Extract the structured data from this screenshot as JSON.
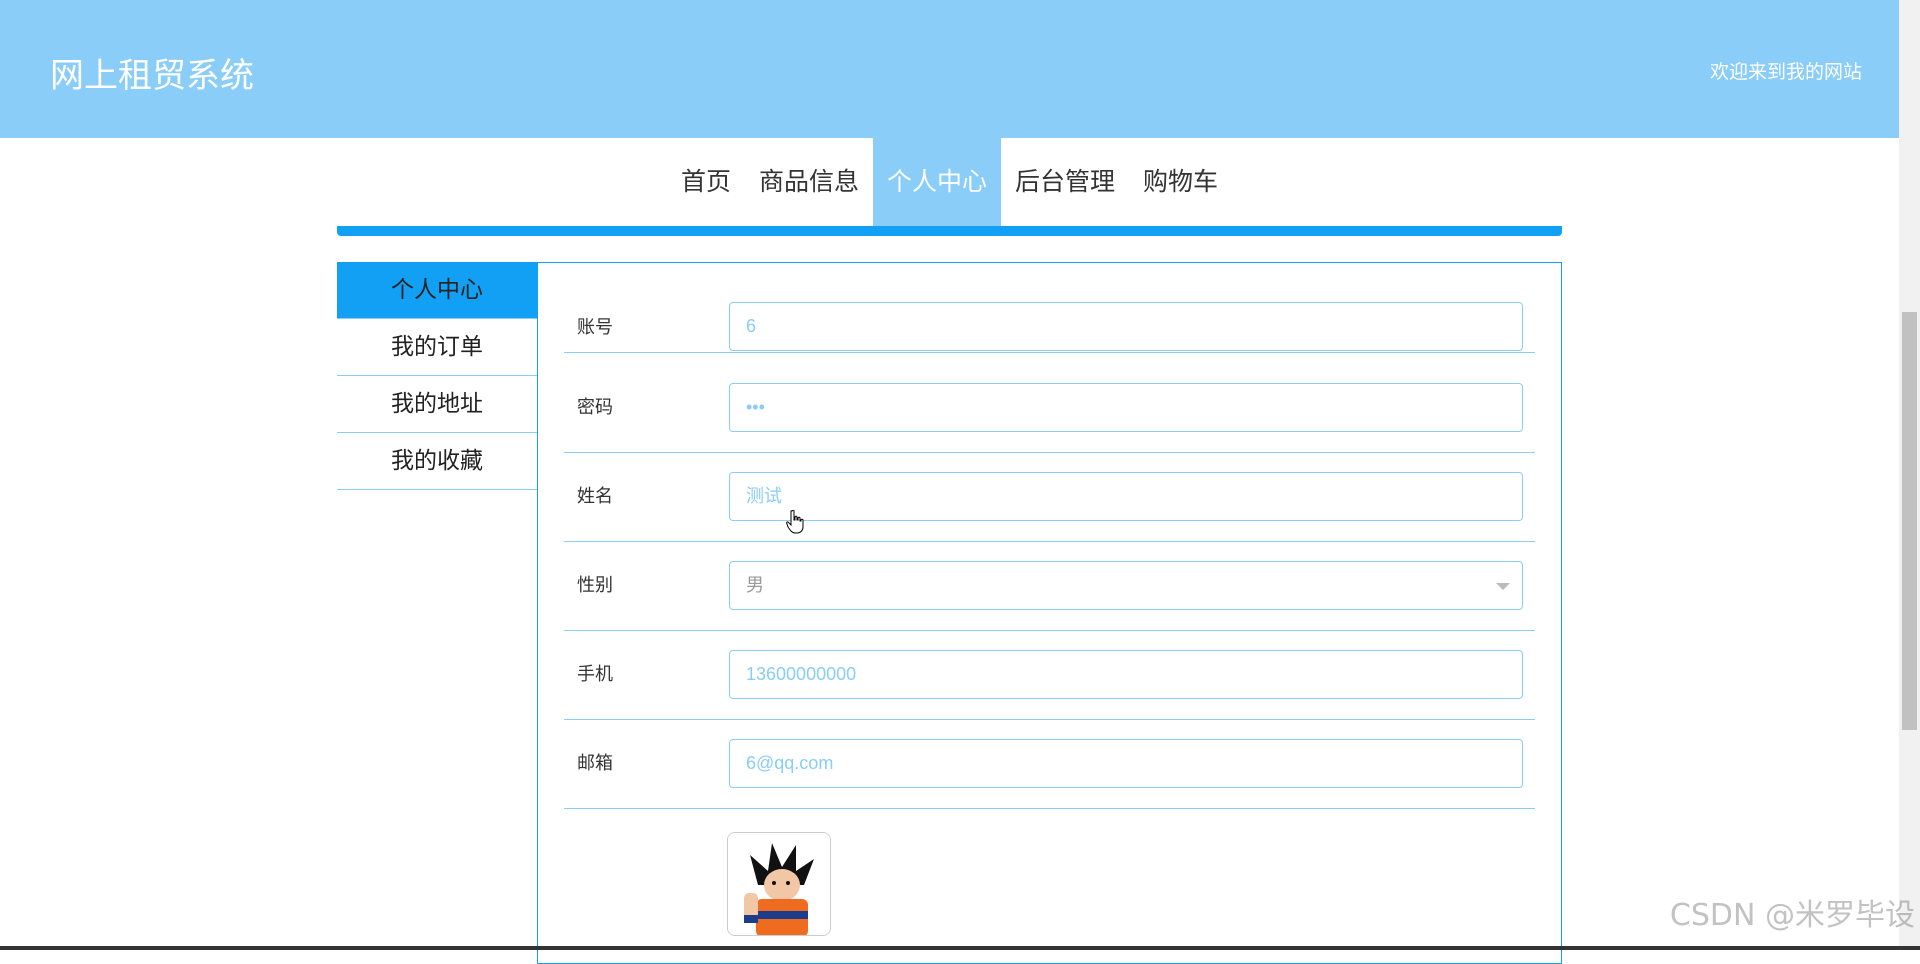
{
  "header": {
    "site_title": "网上租贸系统",
    "welcome_text": "欢迎来到我的网站"
  },
  "nav": {
    "items": [
      "首页",
      "商品信息",
      "个人中心",
      "后台管理",
      "购物车"
    ],
    "active": "个人中心"
  },
  "sidebar": {
    "items": [
      "个人中心",
      "我的订单",
      "我的地址",
      "我的收藏"
    ],
    "active": "个人中心"
  },
  "form": {
    "account": {
      "label": "账号",
      "value": "6"
    },
    "password": {
      "label": "密码",
      "value": "•••"
    },
    "name": {
      "label": "姓名",
      "value": "测试"
    },
    "gender": {
      "label": "性别",
      "value": "男"
    },
    "phone": {
      "label": "手机",
      "value": "13600000000"
    },
    "email": {
      "label": "邮箱",
      "value": "6@qq.com"
    }
  },
  "watermark": "CSDN @米罗毕设",
  "colors": {
    "header_bg": "#89cdf8",
    "accent": "#12a0f5",
    "input_text": "#89cdf8"
  },
  "icons": {
    "cursor": "hand-pointer-icon",
    "dropdown": "chevron-down-icon"
  }
}
